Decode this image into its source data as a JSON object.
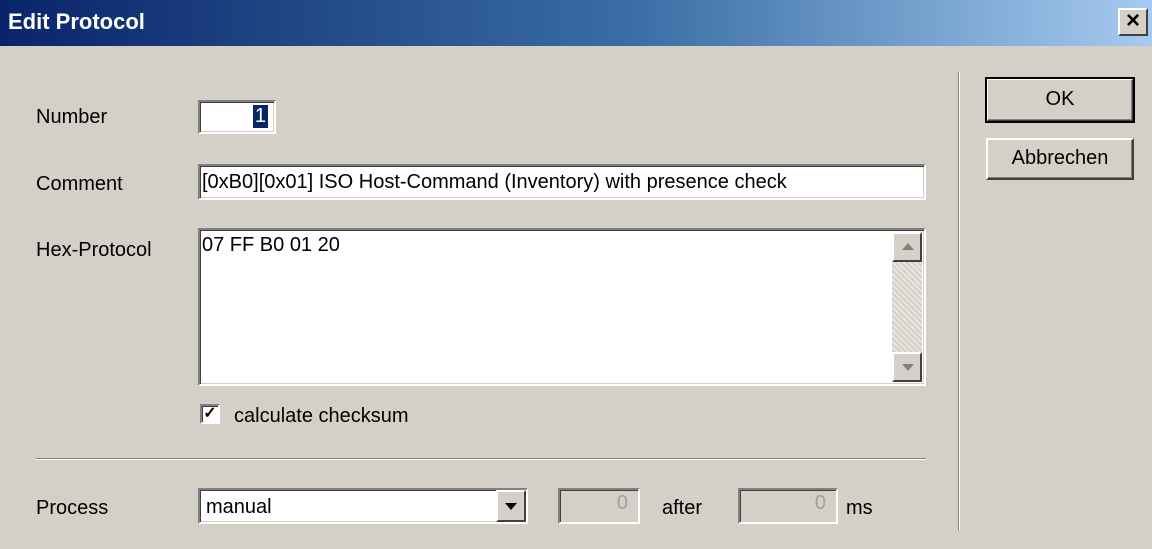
{
  "window": {
    "title": "Edit Protocol",
    "close_glyph": "×"
  },
  "form": {
    "number_label": "Number",
    "number_value": "1",
    "comment_label": "Comment",
    "comment_value": "[0xB0][0x01] ISO Host-Command (Inventory) with presence check",
    "hex_label": "Hex-Protocol",
    "hex_value": "07 FF B0 01 20",
    "checksum_label": "calculate checksum",
    "checksum_checked": true,
    "checkbox_glyph": "✓",
    "process_label": "Process",
    "process_selected": "manual",
    "count_value": "0",
    "after_label": "after",
    "delay_value": "0",
    "ms_label": "ms"
  },
  "buttons": {
    "ok": "OK",
    "cancel": "Abbrechen"
  },
  "icons": {
    "close": "close-icon",
    "scroll_up": "scroll-up-arrow-icon",
    "scroll_down": "scroll-down-arrow-icon",
    "dropdown": "chevron-down-icon",
    "check": "checkmark-icon"
  },
  "colors": {
    "dialog_bg": "#d4d0c8",
    "titlebar_start": "#0a246a",
    "titlebar_end": "#a6caf0",
    "selection": "#0a246a"
  }
}
